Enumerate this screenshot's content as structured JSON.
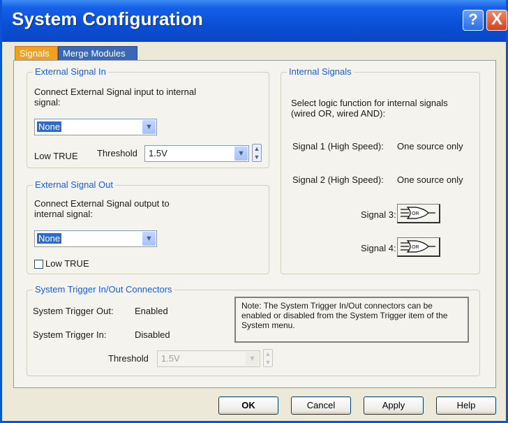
{
  "window": {
    "title": "System Configuration",
    "help_glyph": "?",
    "close_glyph": "X"
  },
  "tabs": [
    "Signals",
    "Merge Modules"
  ],
  "ext_in": {
    "legend": "External Signal In",
    "description": "Connect External Signal input to internal signal:",
    "select_value": "None",
    "low_true_label": "Low TRUE",
    "threshold_label": "Threshold",
    "threshold_value": "1.5V"
  },
  "ext_out": {
    "legend": "External Signal Out",
    "description": "Connect External Signal output to internal signal:",
    "select_value": "None",
    "low_true_label": "Low TRUE",
    "low_true_checked": false
  },
  "internal": {
    "legend": "Internal Signals",
    "description": "Select logic function for internal signals (wired OR, wired AND):",
    "signal1_label": "Signal 1 (High Speed):",
    "signal1_value": "One source only",
    "signal2_label": "Signal 2 (High Speed):",
    "signal2_value": "One source only",
    "signal3_label": "Signal 3:",
    "signal4_label": "Signal 4:",
    "gate_text": "OR"
  },
  "trigger": {
    "legend": "System Trigger In/Out Connectors",
    "out_label": "System Trigger Out:",
    "out_value": "Enabled",
    "in_label": "System Trigger In:",
    "in_value": "Disabled",
    "threshold_label": "Threshold",
    "threshold_value": "1.5V",
    "note": "Note: The System Trigger In/Out connectors can be enabled or disabled from the System Trigger item of the System menu."
  },
  "buttons": {
    "ok": "OK",
    "cancel": "Cancel",
    "apply": "Apply",
    "help": "Help"
  },
  "colors": {
    "title_bar": "#0a4fd6",
    "active_tab": "#f0a020",
    "inactive_tab": "#3a68b8",
    "group_label": "#1c5bd8"
  }
}
